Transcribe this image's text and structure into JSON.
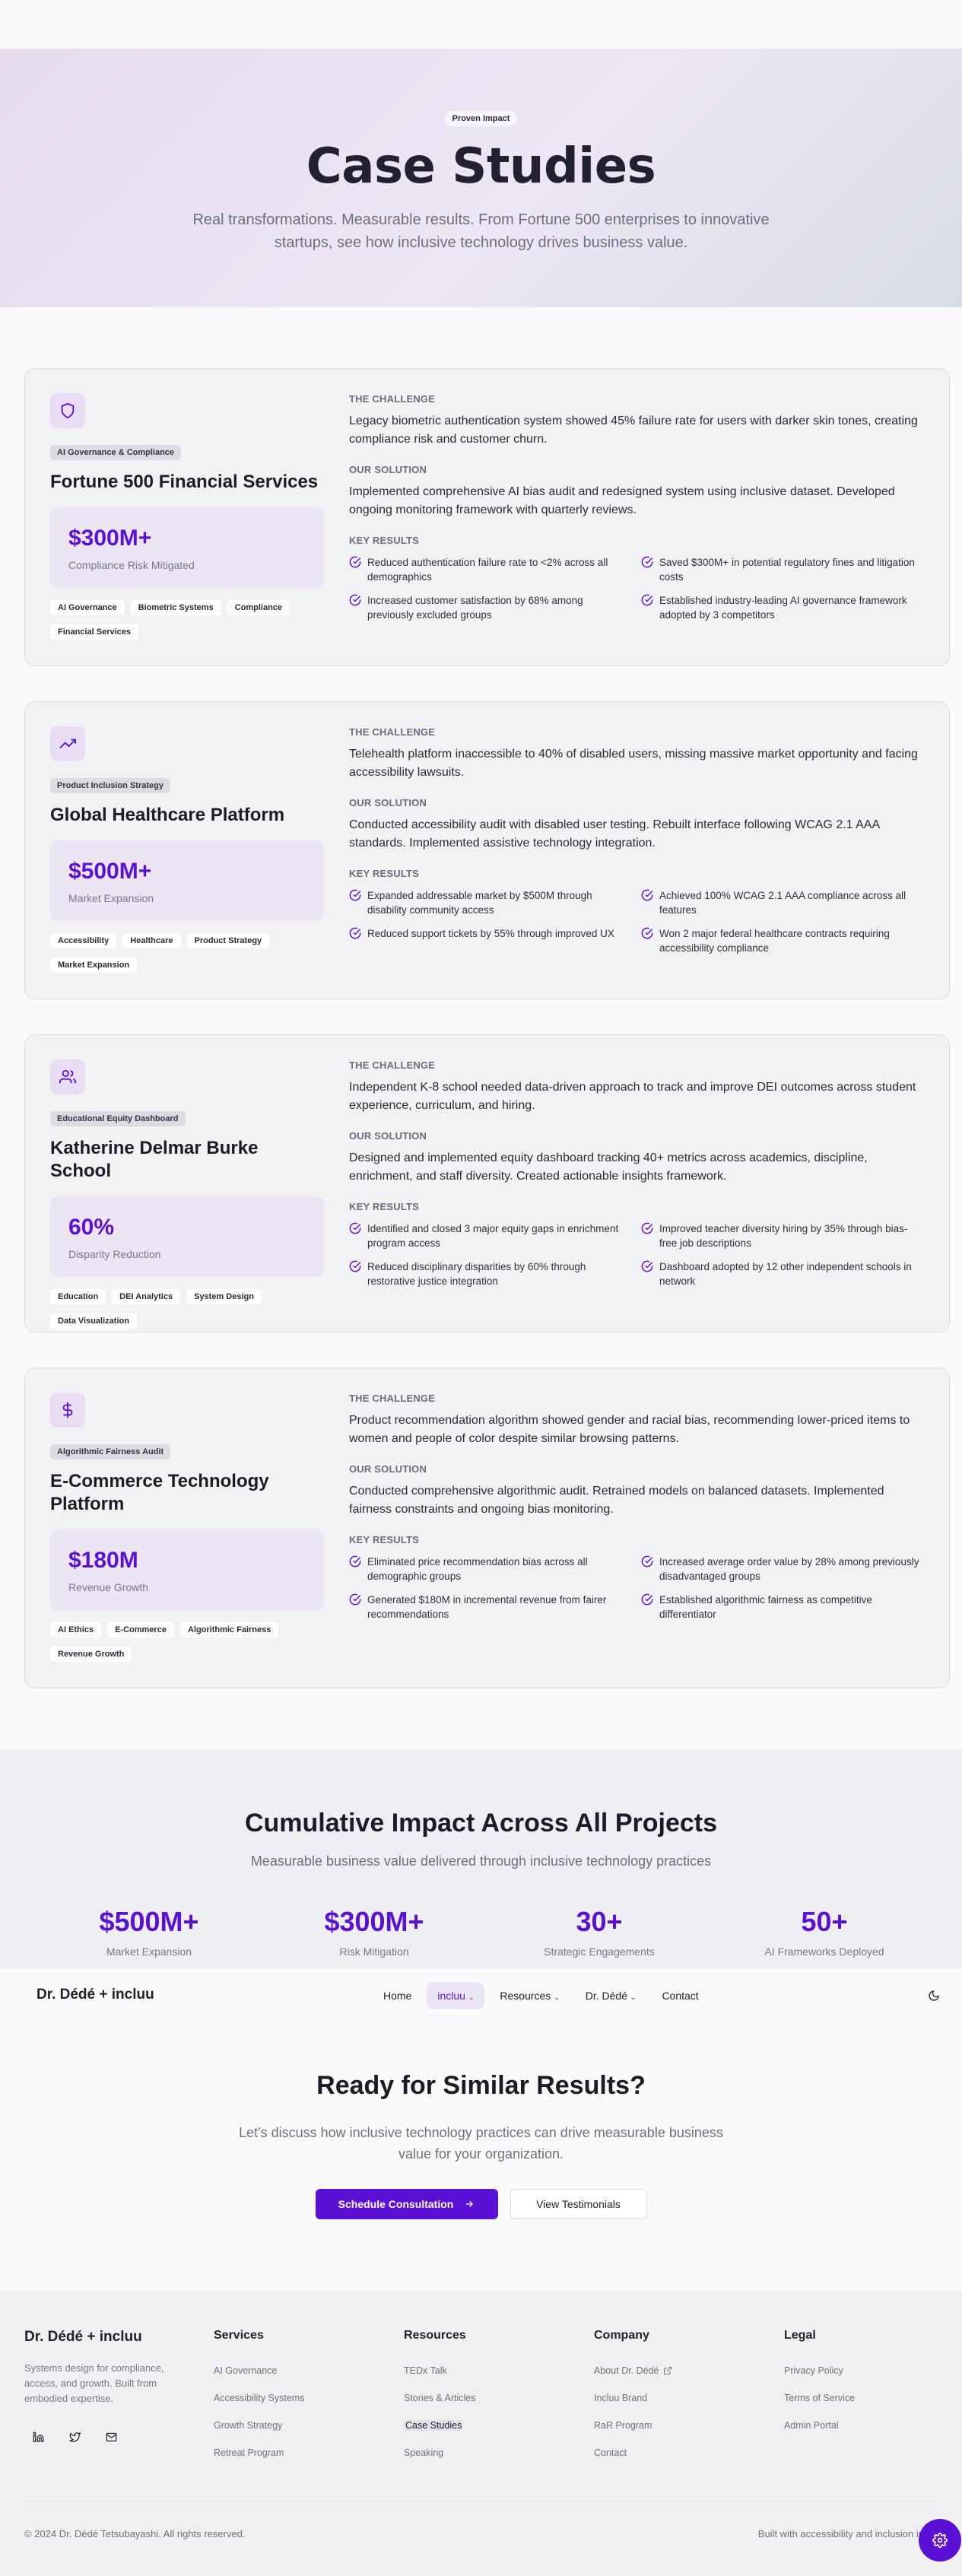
{
  "hero": {
    "badge": "Proven Impact",
    "title": "Case Studies",
    "subtitle": "Real transformations. Measurable results. From Fortune 500 enterprises to innovative startups, see how inclusive technology drives business value."
  },
  "labels": {
    "challenge": "THE CHALLENGE",
    "solution": "OUR SOLUTION",
    "results": "KEY RESULTS"
  },
  "cases": [
    {
      "icon": "shield-icon",
      "category": "AI Governance & Compliance",
      "title": "Fortune 500 Financial Services",
      "metric_value": "$300M+",
      "metric_label": "Compliance Risk Mitigated",
      "tags": [
        "AI Governance",
        "Biometric Systems",
        "Compliance",
        "Financial Services"
      ],
      "challenge": "Legacy biometric authentication system showed 45% failure rate for users with darker skin tones, creating compliance risk and customer churn.",
      "solution": "Implemented comprehensive AI bias audit and redesigned system using inclusive dataset. Developed ongoing monitoring framework with quarterly reviews.",
      "results": [
        "Reduced authentication failure rate to <2% across all demographics",
        "Saved $300M+ in potential regulatory fines and litigation costs",
        "Increased customer satisfaction by 68% among previously excluded groups",
        "Established industry-leading AI governance framework adopted by 3 competitors"
      ]
    },
    {
      "icon": "trending-up-icon",
      "category": "Product Inclusion Strategy",
      "title": "Global Healthcare Platform",
      "metric_value": "$500M+",
      "metric_label": "Market Expansion",
      "tags": [
        "Accessibility",
        "Healthcare",
        "Product Strategy",
        "Market Expansion"
      ],
      "challenge": "Telehealth platform inaccessible to 40% of disabled users, missing massive market opportunity and facing accessibility lawsuits.",
      "solution": "Conducted accessibility audit with disabled user testing. Rebuilt interface following WCAG 2.1 AAA standards. Implemented assistive technology integration.",
      "results": [
        "Expanded addressable market by $500M through disability community access",
        "Achieved 100% WCAG 2.1 AAA compliance across all features",
        "Reduced support tickets by 55% through improved UX",
        "Won 2 major federal healthcare contracts requiring accessibility compliance"
      ]
    },
    {
      "icon": "users-icon",
      "category": "Educational Equity Dashboard",
      "title": "Katherine Delmar Burke School",
      "metric_value": "60%",
      "metric_label": "Disparity Reduction",
      "tags": [
        "Education",
        "DEI Analytics",
        "System Design",
        "Data Visualization"
      ],
      "challenge": "Independent K-8 school needed data-driven approach to track and improve DEI outcomes across student experience, curriculum, and hiring.",
      "solution": "Designed and implemented equity dashboard tracking 40+ metrics across academics, discipline, enrichment, and staff diversity. Created actionable insights framework.",
      "results": [
        "Identified and closed 3 major equity gaps in enrichment program access",
        "Improved teacher diversity hiring by 35% through bias-free job descriptions",
        "Reduced disciplinary disparities by 60% through restorative justice integration",
        "Dashboard adopted by 12 other independent schools in network"
      ]
    },
    {
      "icon": "dollar-icon",
      "category": "Algorithmic Fairness Audit",
      "title": "E-Commerce Technology Platform",
      "metric_value": "$180M",
      "metric_label": "Revenue Growth",
      "tags": [
        "AI Ethics",
        "E-Commerce",
        "Algorithmic Fairness",
        "Revenue Growth"
      ],
      "challenge": "Product recommendation algorithm showed gender and racial bias, recommending lower-priced items to women and people of color despite similar browsing patterns.",
      "solution": "Conducted comprehensive algorithmic audit. Retrained models on balanced datasets. Implemented fairness constraints and ongoing bias monitoring.",
      "results": [
        "Eliminated price recommendation bias across all demographic groups",
        "Increased average order value by 28% among previously disadvantaged groups",
        "Generated $180M in incremental revenue from fairer recommendations",
        "Established algorithmic fairness as competitive differentiator"
      ]
    }
  ],
  "impact": {
    "title": "Cumulative Impact Across All Projects",
    "subtitle": "Measurable business value delivered through inclusive technology practices",
    "stats": [
      {
        "value": "$500M+",
        "label": "Market Expansion"
      },
      {
        "value": "$300M+",
        "label": "Risk Mitigation"
      },
      {
        "value": "30+",
        "label": "Strategic Engagements"
      },
      {
        "value": "50+",
        "label": "AI Frameworks Deployed"
      }
    ]
  },
  "nav": {
    "brand": "Dr. Dédé + incluu",
    "items": [
      "Home",
      "incluu",
      "Resources",
      "Dr. Dédé",
      "Contact"
    ]
  },
  "cta": {
    "title": "Ready for Similar Results?",
    "subtitle": "Let's discuss how inclusive technology practices can drive measurable business value for your organization.",
    "primary": "Schedule Consultation",
    "secondary": "View Testimonials"
  },
  "footer": {
    "brand": "Dr. Dédé + incluu",
    "description": "Systems design for compliance, access, and growth. Built from embodied expertise.",
    "columns": [
      {
        "title": "Services",
        "links": [
          "AI Governance",
          "Accessibility Systems",
          "Growth Strategy",
          "Retreat Program"
        ]
      },
      {
        "title": "Resources",
        "links": [
          "TEDx Talk",
          "Stories & Articles",
          "Case Studies",
          "Speaking"
        ]
      },
      {
        "title": "Company",
        "links": [
          "About Dr. Dédé",
          "Incluu Brand",
          "RaR Program",
          "Contact"
        ]
      },
      {
        "title": "Legal",
        "links": [
          "Privacy Policy",
          "Terms of Service",
          "Admin Portal"
        ]
      }
    ],
    "copyright": "© 2024 Dr. Dédé Tetsubayashi. All rights reserved.",
    "built": "Built with accessibility and inclusion in"
  },
  "colors": {
    "accent": "#5b10d6",
    "hero_tint": "#ede7f3",
    "card_bg": "#f1f2f4"
  }
}
